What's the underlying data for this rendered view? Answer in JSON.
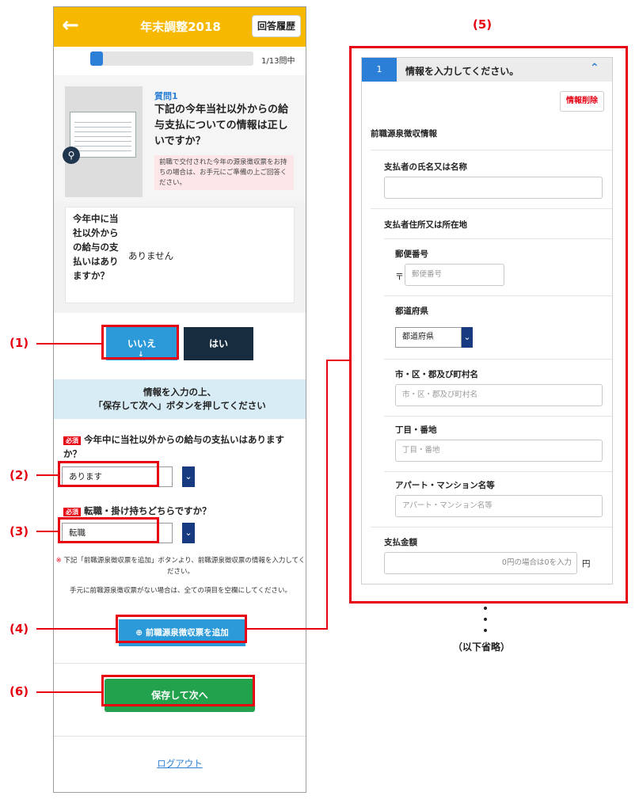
{
  "header": {
    "title": "年末調整2018",
    "history_label": "回答履歴"
  },
  "progress": {
    "text": "1/13問中",
    "fraction": 0.077
  },
  "question": {
    "number": "質問1",
    "text": "下記の今年当社以外からの給与支払についての情報は正しいですか？",
    "note": "前職で交付された今年の源泉徴収票をお持ちの場合は、お手元にご準備の上ご回答ください。"
  },
  "answer_card": {
    "question": "今年中に当社以外からの給与の支払いはありますか？",
    "value": "ありません"
  },
  "choices": {
    "no_label": "いいえ",
    "yes_label": "はい"
  },
  "info_banner": {
    "line1": "情報を入力の上、",
    "line2": "「保存して次へ」ボタンを押してください"
  },
  "form": {
    "required_badge": "必須",
    "q1_label": "今年中に当社以外からの給与の支払いはありますか？",
    "q1_value": "あります",
    "q2_label": "転職・掛け持ちどちらですか？",
    "q2_value": "転職",
    "note_mark": "※",
    "note1": "下記「前職源泉徴収票を追加」ボタンより、前職源泉徴収票の情報を入力してください。",
    "note2": "手元に前職源泉徴収票がない場合は、全ての項目を空欄にしてください。"
  },
  "buttons": {
    "add_label": "前職源泉徴収票を追加",
    "save_label": "保存して次へ",
    "logout_label": "ログアウト"
  },
  "callouts": {
    "c1": "(1)",
    "c2": "(2)",
    "c3": "(3)",
    "c4": "(4)",
    "c5": "(5)",
    "c6": "(6)"
  },
  "panel": {
    "number": "1",
    "title": "情報を入力してください。",
    "delete_label": "情報削除",
    "section_title": "前職源泉徴収情報",
    "payer_name_label": "支払者の氏名又は名称",
    "payer_address_label": "支払者住所又は所在地",
    "postal_label": "郵便番号",
    "postal_mark": "〒",
    "postal_placeholder": "郵便番号",
    "prefecture_label": "都道府県",
    "prefecture_value": "都道府県",
    "city_label": "市・区・郡及び町村名",
    "city_placeholder": "市・区・郡及び町村名",
    "block_label": "丁目・番地",
    "block_placeholder": "丁目・番地",
    "building_label": "アパート・マンション名等",
    "building_placeholder": "アパート・マンション名等",
    "amount_label": "支払金額",
    "amount_placeholder": "0円の場合は0を入力",
    "amount_unit": "円"
  },
  "omitted_text": "（以下省略）",
  "colors": {
    "header": "#f6b900",
    "accent_blue": "#2c9ad8",
    "navy": "#172c3e",
    "red": "#e60012",
    "green": "#23a24d"
  }
}
